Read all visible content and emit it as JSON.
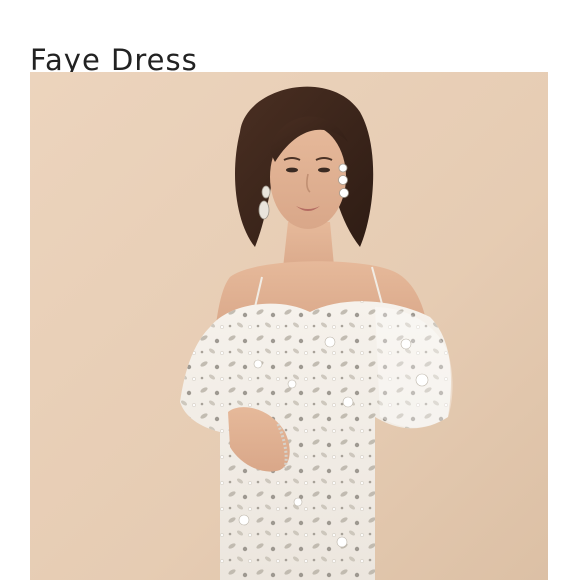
{
  "product": {
    "title": "Faye Dress"
  },
  "colors": {
    "background": "#ffffff",
    "photo_backdrop": "#e8cfb8",
    "title_text": "#222222"
  }
}
